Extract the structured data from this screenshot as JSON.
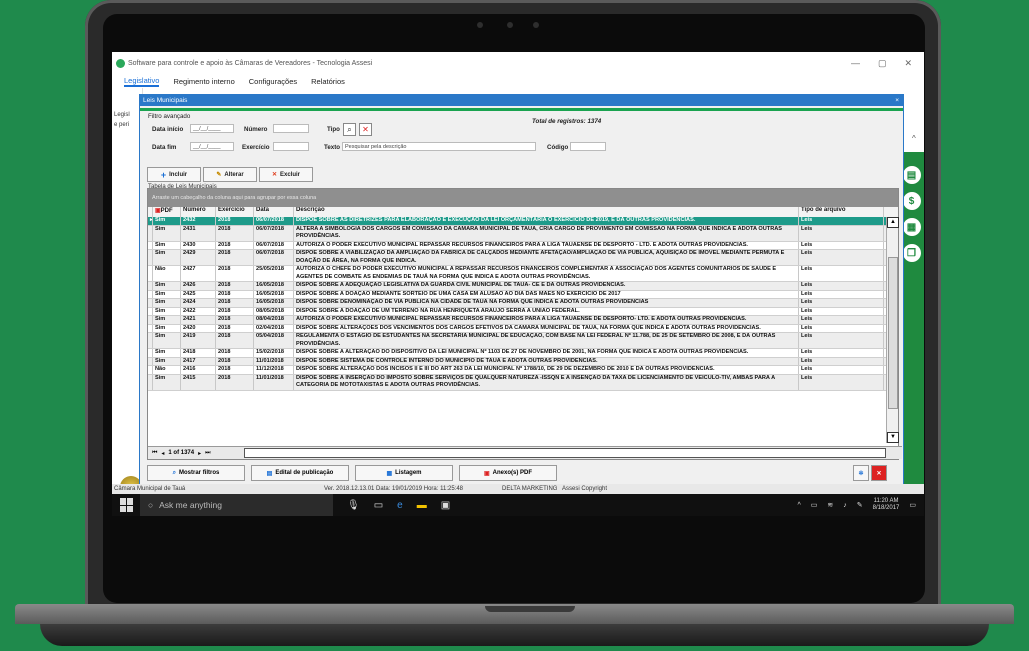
{
  "app": {
    "title": "Software para controle e apoio às Câmaras de Vereadores - Tecnologia Assesi",
    "window_controls": [
      "—",
      "▢",
      "✕"
    ]
  },
  "menu": {
    "tabs": [
      "Legislativo",
      "Regimento interno",
      "Configurações",
      "Relatórios"
    ]
  },
  "left": {
    "line1": "Legisl",
    "line2": "e peri"
  },
  "dialog": {
    "title": "Leis Municipais",
    "close": "×",
    "filter_title": "Filtro avançado",
    "total": "Total de registros: 1374",
    "labels": {
      "data_inicio": "Data início",
      "data_fim": "Data fim",
      "numero": "Número",
      "exercicio": "Exercício",
      "tipo": "Tipo",
      "texto": "Texto",
      "codigo": "Código"
    },
    "date_placeholder": "__/__/____",
    "texto_placeholder": "Pesquisar pela descrição",
    "buttons": {
      "incluir": "Incluir",
      "alterar": "Alterar",
      "excluir": "Excluir"
    },
    "table_caption": "Tabela de Leis Municipais",
    "group_hint": "Arraste um cabeçalho da coluna aqui para agrupar por essa coluna",
    "columns": [
      "PDF",
      "Número",
      "Exercício",
      "Data",
      "Descrição",
      "Tipo de arquivo"
    ],
    "rows": [
      {
        "pdf": "Sim",
        "numero": "2432",
        "exercicio": "2018",
        "data": "06/07/2018",
        "descricao": "DISPÕE SOBRE AS DIRETRIZES PARA ELABORAÇÃO E EXECUÇÃO DA LEI ORÇAMENTÁRIA O EXERCÍCIO DE 2019, E DÁ OUTRAS PROVIDÊNCIAS.",
        "tipo": "Leis"
      },
      {
        "pdf": "Sim",
        "numero": "2431",
        "exercicio": "2018",
        "data": "06/07/2018",
        "descricao": "ALTERA A SIMBOLOGIA DOS CARGOS EM COMISSÃO DA CÂMARA MUNICIPAL DE TAUÁ, CRIA CARGO DE PROVIMENTO EM COMISSÃO NA FORMA QUE INDICA E ADOTA OUTRAS PROVIDÊNCIAS.",
        "tipo": "Leis"
      },
      {
        "pdf": "Sim",
        "numero": "2430",
        "exercicio": "2018",
        "data": "06/07/2018",
        "descricao": "AUTORIZA O PODER EXECUTIVO MUNICIPAL REPASSAR RECURSOS FINANCEIROS PARA A LIGA TAUAENSE DE DESPORTO - LTD. E ADOTA OUTRAS PROVIDÊNCIAS.",
        "tipo": "Leis"
      },
      {
        "pdf": "Sim",
        "numero": "2429",
        "exercicio": "2018",
        "data": "06/07/2018",
        "descricao": "DISPÕE SOBRE A VIABILIZAÇÃO DA AMPLIAÇÃO DA FÁBRICA DE CALÇADOS MEDIANTE AFETAÇÃO/AMPLIAÇÃO DE VIA PÚBLICA, AQUISIÇÃO DE IMÓVEL MEDIANTE PERMUTA E DOAÇÃO DE ÁREA, NA FORMA QUE INDICA.",
        "tipo": "Leis"
      },
      {
        "pdf": "Não",
        "numero": "2427",
        "exercicio": "2018",
        "data": "25/05/2018",
        "descricao": "AUTORIZA O CHEFE DO PODER EXECUTIVO MUNICIPAL A REPASSAR RECURSOS FINANCEIROS COMPLEMENTAR À ASSOCIAÇÃO DOS AGENTES COMUNITÁRIOS DE SAÚDE E AGENTES DE COMBATE AS ENDEMIAS DE TAUÁ NA FORMA QUE INDICA E ADOTA OUTRAS PROVIDÊNCIAS.",
        "tipo": "Leis"
      },
      {
        "pdf": "Sim",
        "numero": "2426",
        "exercicio": "2018",
        "data": "16/05/2018",
        "descricao": "DISPÕE SOBRE A ADEQUAÇÃO LEGISLATIVA DA GUARDA CIVIL MUNICIPAL DE TAUÁ- CE E DÁ OUTRAS PROVIDÊNCIAS.",
        "tipo": "Leis"
      },
      {
        "pdf": "Sim",
        "numero": "2425",
        "exercicio": "2018",
        "data": "16/05/2018",
        "descricao": "DISPÕE SOBRE A DOAÇÃO MEDIANTE SORTEIO DE UMA CASA EM ALUSÃO AO DIA DAS MÃES NO EXERCÍCIO DE 2017",
        "tipo": "Leis"
      },
      {
        "pdf": "Sim",
        "numero": "2424",
        "exercicio": "2018",
        "data": "16/05/2018",
        "descricao": "DISPÕE SOBRE DENOMINAÇÃO DE VIA PÚBLICA NA CIDADE DE TAUÁ NA FORMA QUE INDICA E ADOTA OUTRAS PROVIDÊNCIAS",
        "tipo": "Leis"
      },
      {
        "pdf": "Sim",
        "numero": "2422",
        "exercicio": "2018",
        "data": "08/05/2018",
        "descricao": "DISPÕE SOBRE A DOAÇÃO DE UM TERRENO NA RUA HENRIQUETA ARAÚJO SERRA A UNIÃO FEDERAL.",
        "tipo": "Leis"
      },
      {
        "pdf": "Sim",
        "numero": "2421",
        "exercicio": "2018",
        "data": "08/04/2018",
        "descricao": "AUTORIZA O PODER EXECUTIVO MUNICIPAL REPASSAR RECURSOS FINANCEIROS PARA A LIGA TAUAENSE DE DESPORTO- LTD. E ADOTA OUTRAS PROVIDÊNCIAS.",
        "tipo": "Leis"
      },
      {
        "pdf": "Sim",
        "numero": "2420",
        "exercicio": "2018",
        "data": "02/04/2018",
        "descricao": "DISPÕE SOBRE ALTERAÇÕES DOS VENCIMENTOS DOS CARGOS EFETIVOS DA CÂMARA MUNICIPAL DE TAUÁ, NA FORMA QUE INDICA E ADOTA OUTRAS PROVIDÊNCIAS.",
        "tipo": "Leis"
      },
      {
        "pdf": "Sim",
        "numero": "2419",
        "exercicio": "2018",
        "data": "05/04/2018",
        "descricao": "REGULAMENTA O ESTÁGIO DE ESTUDANTES NA SECRETARIA MUNICIPAL DE EDUCAÇÃO, COM BASE NA LEI FEDERAL Nº 11.788, DE 25 DE SETEMBRO DE 2008, E DÁ OUTRAS PROVIDÊNCIAS.",
        "tipo": "Leis"
      },
      {
        "pdf": "Sim",
        "numero": "2418",
        "exercicio": "2018",
        "data": "15/02/2018",
        "descricao": "DISPÕE SOBRE A ALTERAÇÃO DO DISPOSITIVO DA LEI MUNICIPAL Nº 1103 DE 27 DE NOVEMBRO DE 2001, NA FORMA QUE INDICA E ADOTA OUTRAS PROVIDÊNCIAS.",
        "tipo": "Leis"
      },
      {
        "pdf": "Sim",
        "numero": "2417",
        "exercicio": "2018",
        "data": "11/01/2018",
        "descricao": "DISPÕE SOBRE SISTEMA DE CONTROLE INTERNO DO MUNICÍPIO DE TAUÁ E ADOTA OUTRAS PROVIDÊNCIAS.",
        "tipo": "Leis"
      },
      {
        "pdf": "Não",
        "numero": "2416",
        "exercicio": "2018",
        "data": "11/12/2018",
        "descricao": "DISPÕE SOBRE ALTERAÇÃO DOS INCISOS II E III DO ART 263 DA LEI MUNICIPAL Nº 1788/10, DE 29 DE DEZEMBRO DE 2010 E DÁ OUTRAS PROVIDÊNCIAS.",
        "tipo": "Leis"
      },
      {
        "pdf": "Sim",
        "numero": "2415",
        "exercicio": "2018",
        "data": "11/01/2018",
        "descricao": "DISPÕE SOBRE A INSERÇÃO DO IMPOSTO SOBRE SERVIÇOS DE QUALQUER NATUREZA -ISSQN E A INSENÇÃO DA TAXA DE LICENCIAMENTO DE VEÍCULO-TIV, AMBAS PARA A CATEGORIA DE MOTOTAXISTAS E ADOTA OUTRAS PROVIDÊNCIAS.",
        "tipo": "Leis"
      }
    ],
    "pager": {
      "text": "1 of 1374",
      "first": "⏮",
      "prev": "◂",
      "next": "▸",
      "last": "⏭"
    },
    "bottom_buttons": {
      "filtros": "Mostrar filtros",
      "edital": "Edital de publicação",
      "listagem": "Listagem",
      "anexos": "Anexo(s) PDF"
    }
  },
  "status": {
    "left": "Câmara Municipal de Tauá",
    "version": "Ver. 2018.12.13.01  Data: 19/01/2019  Hora: 11:25:48",
    "company": "DELTA MARKETING",
    "copyright": "Assesi Copyright"
  },
  "taskbar": {
    "search": "Ask me anything",
    "time": "11:20 AM",
    "date": "8/18/2017"
  }
}
